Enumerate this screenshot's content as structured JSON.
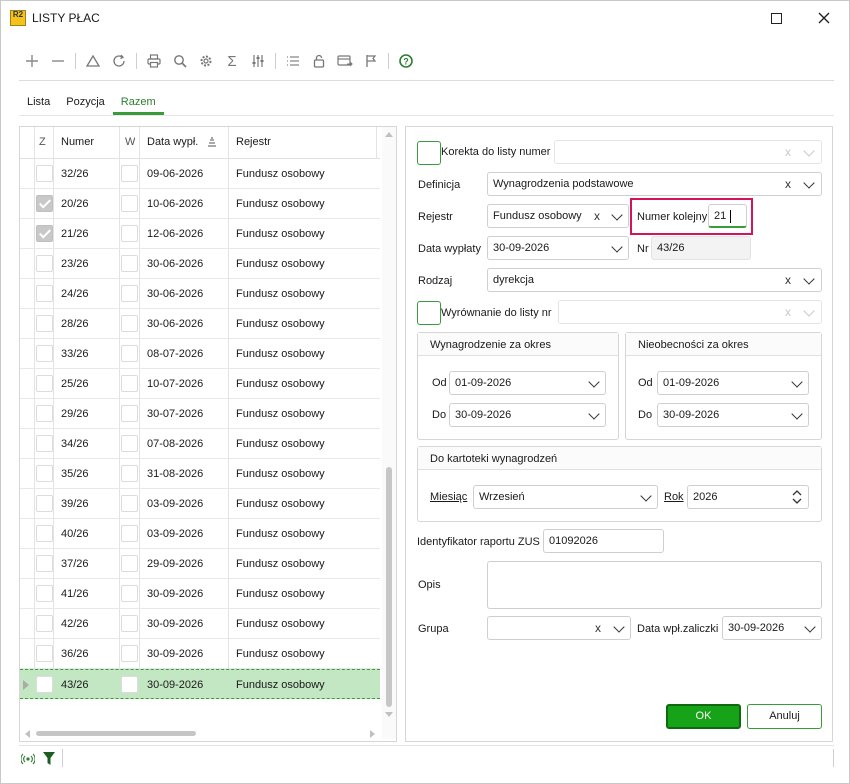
{
  "window": {
    "title": "LISTY PŁAC",
    "app_icon_text": "R2"
  },
  "tabs": [
    {
      "label": "Lista",
      "active": false
    },
    {
      "label": "Pozycja",
      "active": false
    },
    {
      "label": "Razem",
      "active": true
    }
  ],
  "toolbar": [
    "add-icon",
    "remove-icon",
    "triangle-icon",
    "refresh-icon",
    "print-icon",
    "search-icon",
    "settings-gear-icon",
    "sigma-icon",
    "sliders-icon",
    "list-icon",
    "unlock-icon",
    "card-icon",
    "flag-icon",
    "help-icon"
  ],
  "grid": {
    "columns": [
      {
        "label": "Z"
      },
      {
        "label": "Numer"
      },
      {
        "label": "W"
      },
      {
        "label": "Data wypł."
      },
      {
        "label": "Rejestr"
      }
    ],
    "rows": [
      {
        "checked": false,
        "numer": "32/26",
        "data": "09-06-2026",
        "rejestr": "Fundusz osobowy"
      },
      {
        "checked": true,
        "numer": "20/26",
        "data": "10-06-2026",
        "rejestr": "Fundusz osobowy"
      },
      {
        "checked": true,
        "numer": "21/26",
        "data": "12-06-2026",
        "rejestr": "Fundusz osobowy"
      },
      {
        "checked": false,
        "numer": "23/26",
        "data": "30-06-2026",
        "rejestr": "Fundusz osobowy"
      },
      {
        "checked": false,
        "numer": "24/26",
        "data": "30-06-2026",
        "rejestr": "Fundusz osobowy"
      },
      {
        "checked": false,
        "numer": "28/26",
        "data": "30-06-2026",
        "rejestr": "Fundusz osobowy"
      },
      {
        "checked": false,
        "numer": "33/26",
        "data": "08-07-2026",
        "rejestr": "Fundusz osobowy"
      },
      {
        "checked": false,
        "numer": "25/26",
        "data": "10-07-2026",
        "rejestr": "Fundusz osobowy"
      },
      {
        "checked": false,
        "numer": "29/26",
        "data": "30-07-2026",
        "rejestr": "Fundusz osobowy"
      },
      {
        "checked": false,
        "numer": "34/26",
        "data": "07-08-2026",
        "rejestr": "Fundusz osobowy"
      },
      {
        "checked": false,
        "numer": "35/26",
        "data": "31-08-2026",
        "rejestr": "Fundusz osobowy"
      },
      {
        "checked": false,
        "numer": "39/26",
        "data": "03-09-2026",
        "rejestr": "Fundusz osobowy"
      },
      {
        "checked": false,
        "numer": "40/26",
        "data": "03-09-2026",
        "rejestr": "Fundusz osobowy"
      },
      {
        "checked": false,
        "numer": "37/26",
        "data": "29-09-2026",
        "rejestr": "Fundusz osobowy"
      },
      {
        "checked": false,
        "numer": "41/26",
        "data": "30-09-2026",
        "rejestr": "Fundusz osobowy"
      },
      {
        "checked": false,
        "numer": "42/26",
        "data": "30-09-2026",
        "rejestr": "Fundusz osobowy"
      },
      {
        "checked": false,
        "numer": "36/26",
        "data": "30-09-2026",
        "rejestr": "Fundusz osobowy"
      },
      {
        "checked": false,
        "numer": "43/26",
        "data": "30-09-2026",
        "rejestr": "Fundusz osobowy",
        "selected": true
      }
    ]
  },
  "form": {
    "korekta_label": "Korekta do listy numer",
    "korekta_value": "",
    "definicja_label": "Definicja",
    "definicja_value": "Wynagrodzenia podstawowe",
    "rejestr_label": "Rejestr",
    "rejestr_value": "Fundusz osobowy",
    "numer_kolejny_label": "Numer kolejny",
    "numer_kolejny_value": "21",
    "data_wyplaty_label": "Data wypłaty",
    "data_wyplaty_value": "30-09-2026",
    "nr_label": "Nr",
    "nr_value": "43/26",
    "rodzaj_label": "Rodzaj",
    "rodzaj_value": "dyrekcja",
    "wyrownanie_label": "Wyrównanie do listy nr",
    "wyrownanie_value": "",
    "wyn_okres": {
      "title": "Wynagrodzenie za okres",
      "od_label": "Od",
      "od_value": "01-09-2026",
      "do_label": "Do",
      "do_value": "30-09-2026"
    },
    "nieob_okres": {
      "title": "Nieobecności za okres",
      "od_label": "Od",
      "od_value": "01-09-2026",
      "do_label": "Do",
      "do_value": "30-09-2026"
    },
    "kartoteka": {
      "title": "Do kartoteki wynagrodzeń",
      "miesiac_label": "Miesiąc",
      "miesiac_value": "Wrzesień",
      "rok_label": "Rok",
      "rok_value": "2026"
    },
    "zus_label": "Identyfikator raportu ZUS",
    "zus_value": "01092026",
    "opis_label": "Opis",
    "opis_value": "",
    "grupa_label": "Grupa",
    "grupa_value": "",
    "data_wpl_label": "Data wpł.zaliczki",
    "data_wpl_value": "30-09-2026"
  },
  "buttons": {
    "ok": "OK",
    "cancel": "Anuluj"
  },
  "colors": {
    "accent": "#3a9b3a",
    "ok_button": "#17a317",
    "selected_row": "#c3e6c3",
    "highlight_border": "#d4145a"
  }
}
